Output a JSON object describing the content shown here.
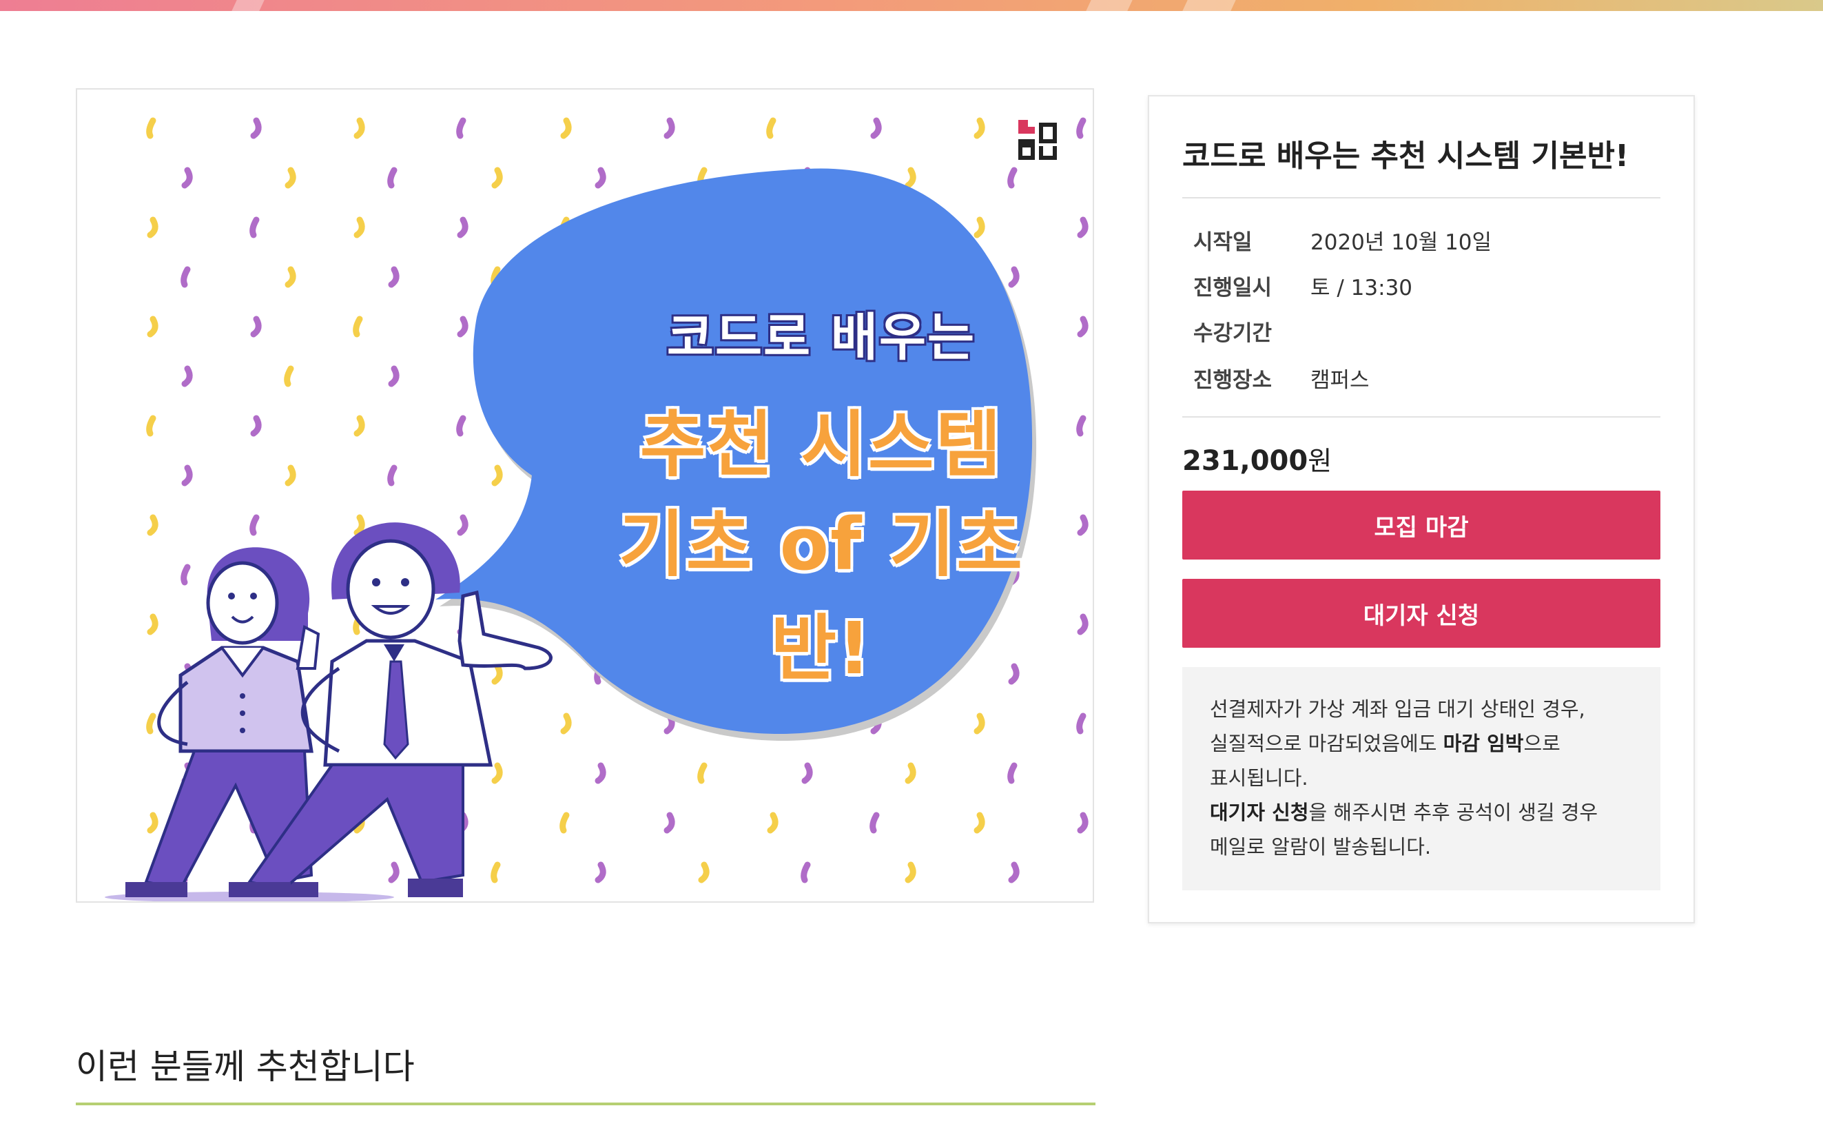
{
  "colors": {
    "accent": "#d9375e",
    "bubble": "#5287ea",
    "confetti_purple": "#b06cc8",
    "confetti_yellow": "#f5cf4a",
    "character_purple": "#6b4fc0",
    "section_line": "#b6cf72"
  },
  "banner": {
    "logo_icon": "logo-icon",
    "line1": "코드로 배우는",
    "line2": "추천 시스템",
    "line3": "기초 of 기초반!"
  },
  "course": {
    "title": "코드로 배우는 추천 시스템 기본반!",
    "info": [
      {
        "label": "시작일",
        "value": "2020년 10월 10일"
      },
      {
        "label": "진행일시",
        "value": "토 / 13:30"
      },
      {
        "label": "수강기간",
        "value": ""
      },
      {
        "label": "진행장소",
        "value": "캠퍼스"
      }
    ],
    "price_number": "231,000",
    "price_unit": "원",
    "closed_button": "모집 마감",
    "waitlist_button": "대기자 신청",
    "notice": {
      "line1": "선결제자가 가상 계좌 입금 대기 상태인 경우,",
      "line2_a": "실질적으로 마감되었음에도 ",
      "line2_b": "마감 임박",
      "line2_c": "으로",
      "line3": "표시됩니다.",
      "line4_a": "대기자 신청",
      "line4_b": "을 해주시면 추후 공석이 생길 경우",
      "line5": "메일로 알람이 발송됩니다."
    }
  },
  "section": {
    "title": "이런 분들께 추천합니다"
  }
}
